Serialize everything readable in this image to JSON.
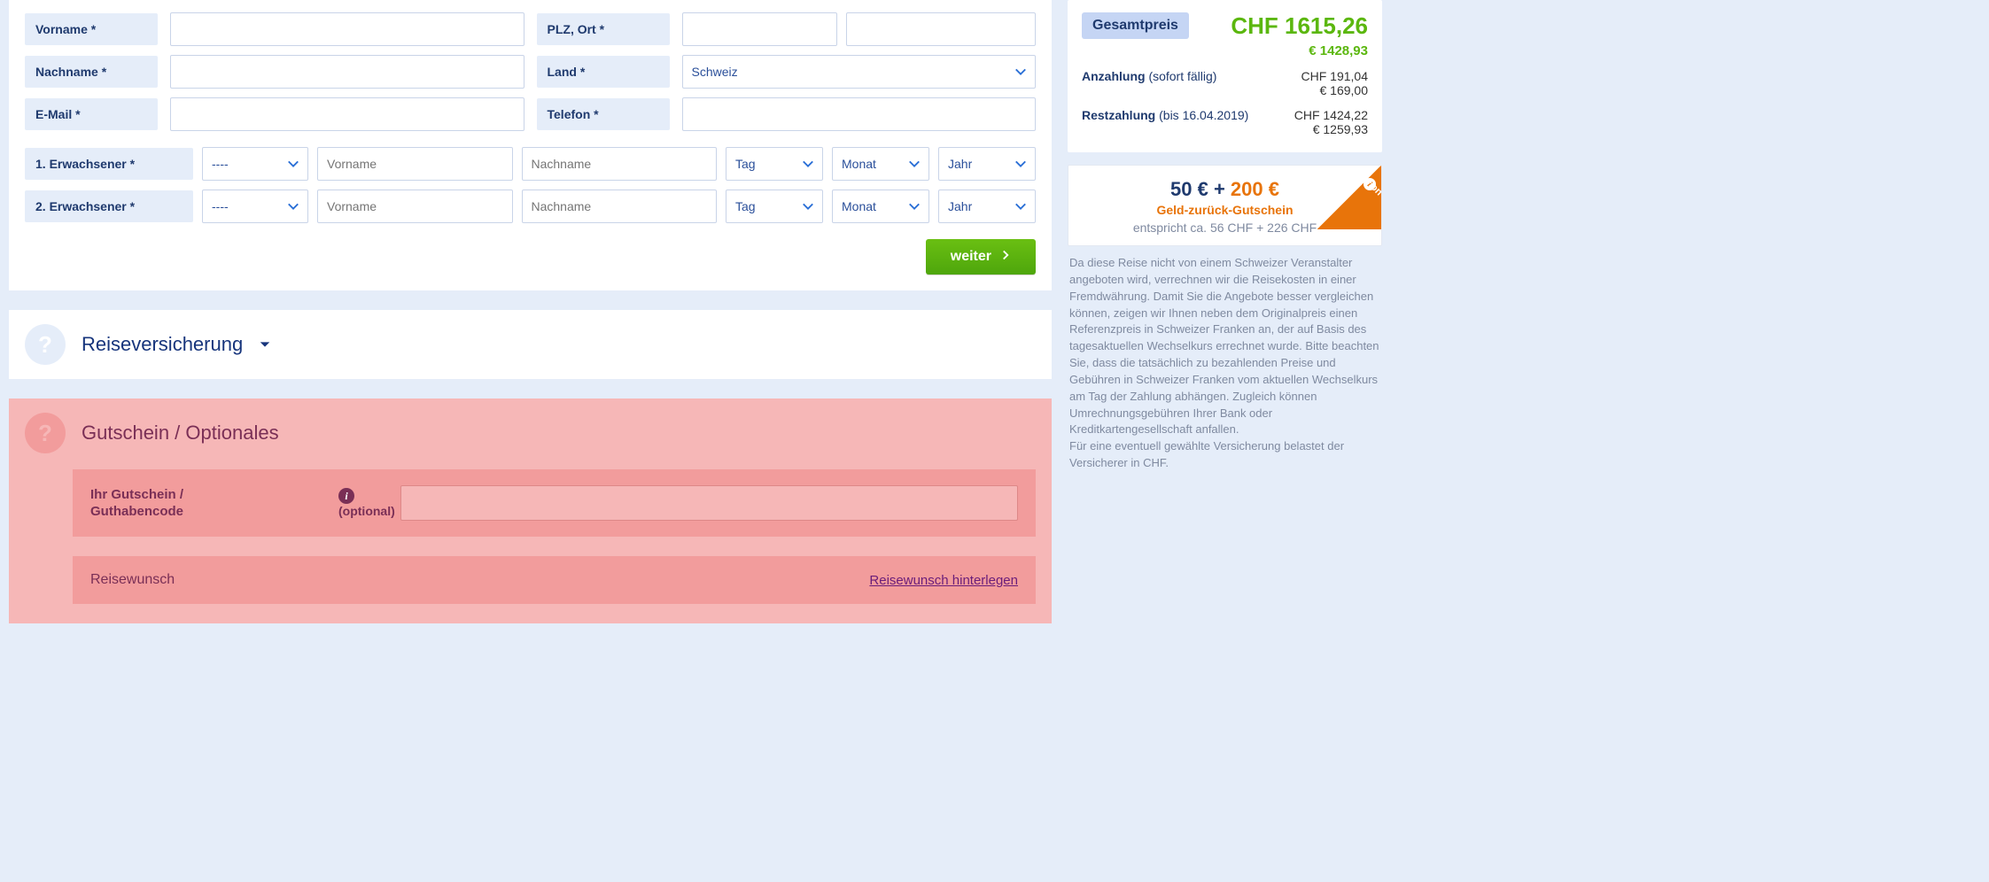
{
  "form": {
    "vorname_label": "Vorname *",
    "nachname_label": "Nachname *",
    "email_label": "E-Mail *",
    "plz_label": "PLZ, Ort *",
    "land_label": "Land *",
    "land_value": "Schweiz",
    "telefon_label": "Telefon *",
    "weiter_label": "weiter"
  },
  "travelers": [
    {
      "label": "1. Erwachsener *",
      "title": "----",
      "vorname_ph": "Vorname",
      "nachname_ph": "Nachname",
      "tag_ph": "Tag",
      "monat_ph": "Monat",
      "jahr_ph": "Jahr"
    },
    {
      "label": "2. Erwachsener *",
      "title": "----",
      "vorname_ph": "Vorname",
      "nachname_ph": "Nachname",
      "tag_ph": "Tag",
      "monat_ph": "Monat",
      "jahr_ph": "Jahr"
    }
  ],
  "insurance": {
    "title": "Reiseversicherung"
  },
  "coupon": {
    "section_title": "Gutschein / Optionales",
    "label_line1": "Ihr Gutschein /",
    "label_line2": "Guthabencode",
    "optional": "(optional)",
    "wish_label": "Reisewunsch",
    "wish_link": "Reisewunsch hinterlegen"
  },
  "summary": {
    "gesamt_label": "Gesamtpreis",
    "gesamt_chf": "CHF 1615,26",
    "gesamt_eur": "€ 1428,93",
    "anzahlung_label": "Anzahlung",
    "anzahlung_note": "(sofort fällig)",
    "anzahlung_chf": "CHF 191,04",
    "anzahlung_eur": "€ 169,00",
    "rest_label": "Restzahlung",
    "rest_note": "(bis 16.04.2019)",
    "rest_chf": "CHF 1424,22",
    "rest_eur": "€ 1259,93"
  },
  "promo": {
    "l1_blue": "50 € + ",
    "l1_orange": "200 €",
    "l2": "Geld-zurück-Gutschein",
    "l3": "entspricht ca. 56 CHF + 226 CHF",
    "corner": "Aktion"
  },
  "disclaimer": "Da diese Reise nicht von einem Schweizer Veranstalter angeboten wird, verrechnen wir die Reisekosten in einer Fremdwährung. Damit Sie die Angebote besser vergleichen können, zeigen wir Ihnen neben dem Originalpreis einen Referenzpreis in Schweizer Franken an, der auf Basis des tagesaktuellen Wechselkurs errechnet wurde. Bitte beachten Sie, dass die tatsächlich zu bezahlenden Preise und Gebühren in Schweizer Franken vom aktuellen Wechselkurs am Tag der Zahlung abhängen. Zugleich können Umrechnungsgebühren Ihrer Bank oder Kreditkartengesellschaft anfallen.\nFür eine eventuell gewählte Versicherung belastet der Versicherer in CHF."
}
